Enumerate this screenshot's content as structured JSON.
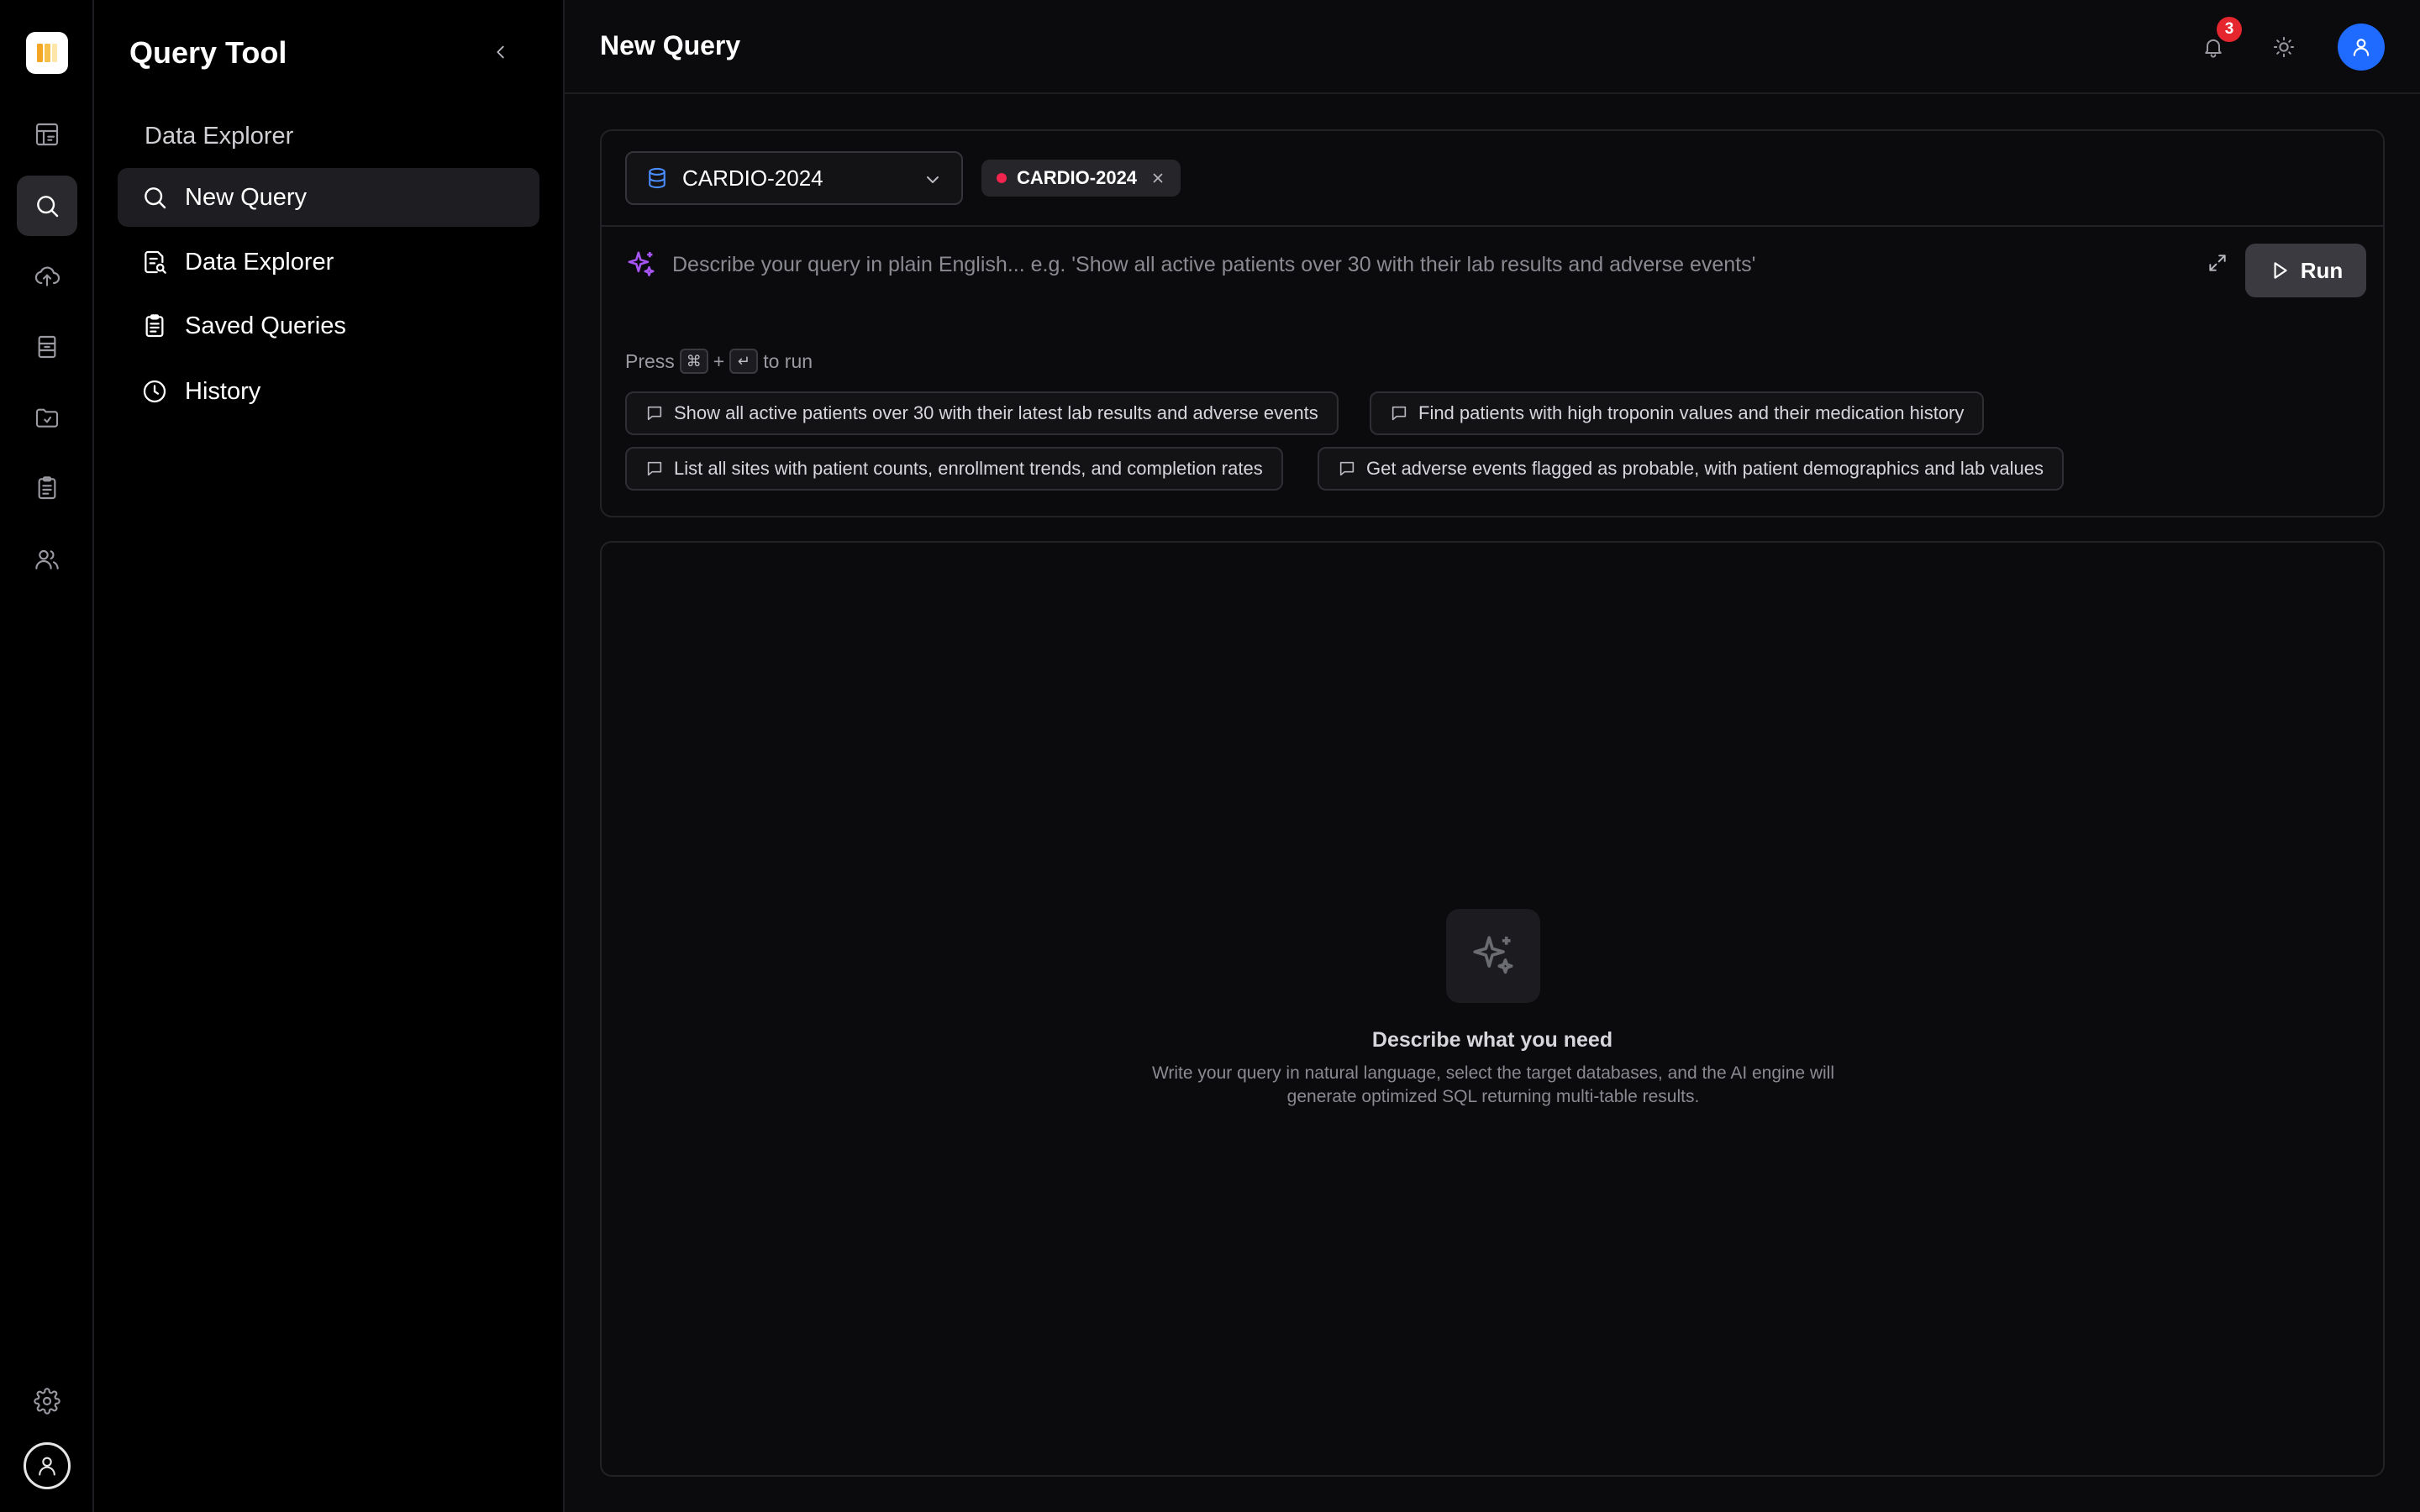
{
  "app": {
    "title": "Query Tool",
    "section_label": "Data Explorer"
  },
  "rail": {
    "icons": [
      "layout-icon",
      "search-icon",
      "upload-cloud-icon",
      "archive-icon",
      "folder-icon",
      "clipboard-icon",
      "users-icon",
      "gear-icon",
      "user-icon"
    ],
    "active": "search-icon"
  },
  "sidebar": {
    "items": [
      {
        "label": "New Query",
        "icon": "search-icon",
        "active": true
      },
      {
        "label": "Data Explorer",
        "icon": "document-search-icon",
        "active": false
      },
      {
        "label": "Saved Queries",
        "icon": "clipboard-icon",
        "active": false
      },
      {
        "label": "History",
        "icon": "clock-icon",
        "active": false
      }
    ]
  },
  "header": {
    "title": "New Query",
    "notification_count": "3"
  },
  "query": {
    "database": "CARDIO-2024",
    "selected_chip": "CARDIO-2024",
    "placeholder": "Describe your query in plain English... e.g. 'Show all active patients over 30 with their lab results and adverse events'",
    "value": "",
    "run_label": "Run",
    "hint_prefix": "Press",
    "hint_key1": "⌘",
    "hint_plus": "+",
    "hint_key2": "↵",
    "hint_suffix": "to run",
    "suggestions": [
      "Show all active patients over 30 with their latest lab results and adverse events",
      "Find patients with high troponin values and their medication history",
      "List all sites with patient counts, enrollment trends, and completion rates",
      "Get adverse events flagged as probable, with patient demographics and lab values"
    ]
  },
  "empty_state": {
    "title": "Describe what you need",
    "description": "Write your query in natural language, select the target databases, and the AI engine will generate optimized SQL returning multi-table results."
  },
  "colors": {
    "background": "#0b0b0d",
    "accent_blue": "#1f6bff",
    "sparkle_purple": "#a855f7",
    "database_icon_blue": "#4a8dff",
    "status_dot": "#f0244d",
    "badge_red": "#e5262f",
    "logo_orange": "#f5a524"
  }
}
